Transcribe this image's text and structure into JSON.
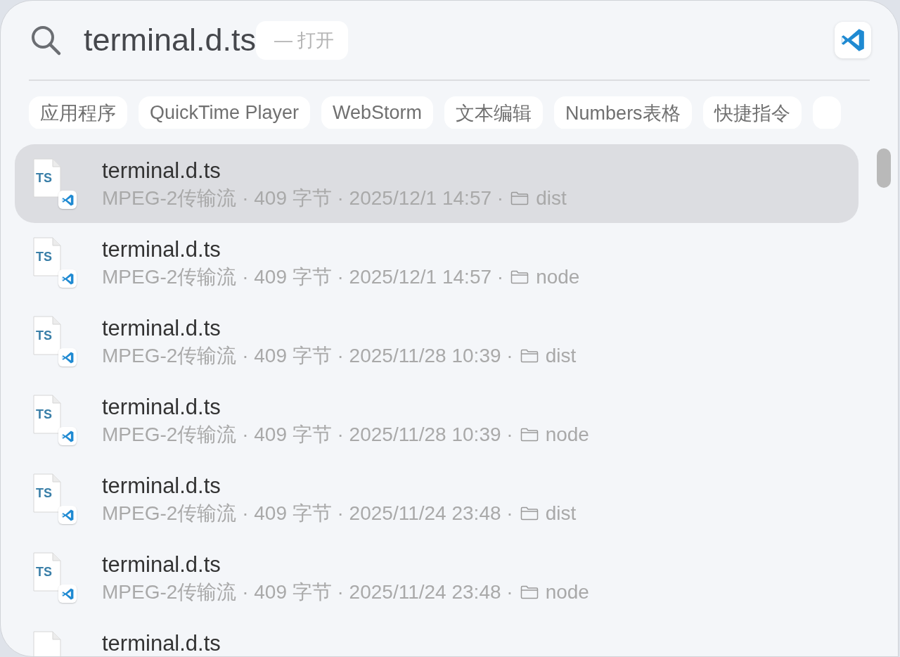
{
  "search": {
    "query": "terminal.d.ts",
    "action_hint": "— 打开"
  },
  "filters": [
    {
      "label": "应用程序"
    },
    {
      "label": "QuickTime Player"
    },
    {
      "label": "WebStorm"
    },
    {
      "label": "文本编辑"
    },
    {
      "label": "Numbers表格"
    },
    {
      "label": "快捷指令"
    }
  ],
  "results": [
    {
      "icon_label": "TS",
      "name": "terminal.d.ts",
      "details": "MPEG-2传输流 · 409 字节 · 2025/12/1 14:57 ·",
      "folder": "dist",
      "selected": true
    },
    {
      "icon_label": "TS",
      "name": "terminal.d.ts",
      "details": "MPEG-2传输流 · 409 字节 · 2025/12/1 14:57 ·",
      "folder": "node",
      "selected": false
    },
    {
      "icon_label": "TS",
      "name": "terminal.d.ts",
      "details": "MPEG-2传输流 · 409 字节 · 2025/11/28 10:39 ·",
      "folder": "dist",
      "selected": false
    },
    {
      "icon_label": "TS",
      "name": "terminal.d.ts",
      "details": "MPEG-2传输流 · 409 字节 · 2025/11/28 10:39 ·",
      "folder": "node",
      "selected": false
    },
    {
      "icon_label": "TS",
      "name": "terminal.d.ts",
      "details": "MPEG-2传输流 · 409 字节 · 2025/11/24 23:48 ·",
      "folder": "dist",
      "selected": false
    },
    {
      "icon_label": "TS",
      "name": "terminal.d.ts",
      "details": "MPEG-2传输流 · 409 字节 · 2025/11/24 23:48 ·",
      "folder": "node",
      "selected": false
    },
    {
      "name": "terminal.d.ts",
      "selected": false
    }
  ]
}
